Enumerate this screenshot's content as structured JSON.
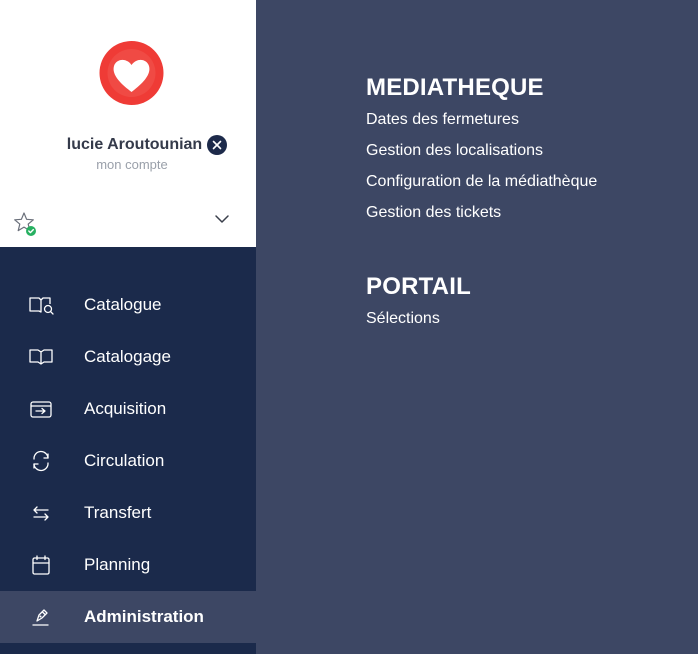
{
  "profile": {
    "user_name": "lucie Aroutounian",
    "account_label": "mon compte",
    "avatar_icon": "heart-icon",
    "favorite_icon": "star-icon",
    "chevron_icon": "chevron-down-icon",
    "close_icon": "close-icon"
  },
  "sidebar": {
    "items": [
      {
        "label": "Catalogue",
        "icon": "book-search-icon"
      },
      {
        "label": "Catalogage",
        "icon": "open-book-icon"
      },
      {
        "label": "Acquisition",
        "icon": "inbox-arrow-icon"
      },
      {
        "label": "Circulation",
        "icon": "refresh-icon"
      },
      {
        "label": "Transfert",
        "icon": "swap-arrows-icon"
      },
      {
        "label": "Planning",
        "icon": "calendar-icon"
      },
      {
        "label": "Administration",
        "icon": "pen-icon",
        "active": true
      }
    ]
  },
  "main": {
    "sections": [
      {
        "title": "MEDIATHEQUE",
        "links": [
          "Dates des fermetures",
          "Gestion des localisations",
          "Configuration de la médiathèque",
          "Gestion des tickets"
        ]
      },
      {
        "title": "PORTAIL",
        "links": [
          "Sélections"
        ]
      }
    ]
  },
  "colors": {
    "sidebar_bg": "#1b2a4b",
    "main_bg": "#3d4764",
    "avatar_red": "#ef3b36"
  }
}
